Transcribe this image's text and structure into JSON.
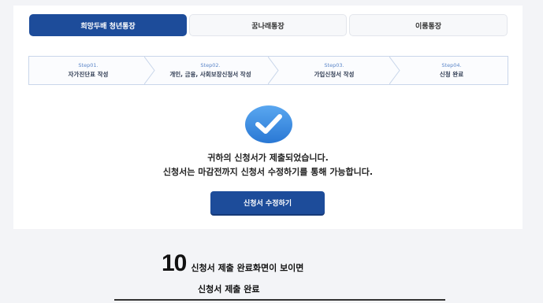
{
  "tabs": [
    {
      "label": "희망두배 청년통장",
      "active": true
    },
    {
      "label": "꿈나래통장",
      "active": false
    },
    {
      "label": "이룸통장",
      "active": false
    }
  ],
  "steps": [
    {
      "num": "Step01.",
      "title": "자가진단표 작성"
    },
    {
      "num": "Step02.",
      "title": "개인, 금융, 사회보장신청서 작성"
    },
    {
      "num": "Step03.",
      "title": "가입신청서 작성"
    },
    {
      "num": "Step04.",
      "title": "신청 완료"
    }
  ],
  "message": {
    "line1": "귀하의 신청서가 제출되었습니다.",
    "line2": "신청서는 마감전까지 신청서 수정하기를 통해 가능합니다."
  },
  "edit_button": "신청서 수정하기",
  "caption": {
    "number": "10",
    "text": "신청서 제출 완료화면이 보이면",
    "text2": "신청서 제출 완료"
  },
  "colors": {
    "primary": "#1d4c9a",
    "check": "#3b8de0"
  },
  "icons": {
    "complete": "check-circle-icon"
  }
}
